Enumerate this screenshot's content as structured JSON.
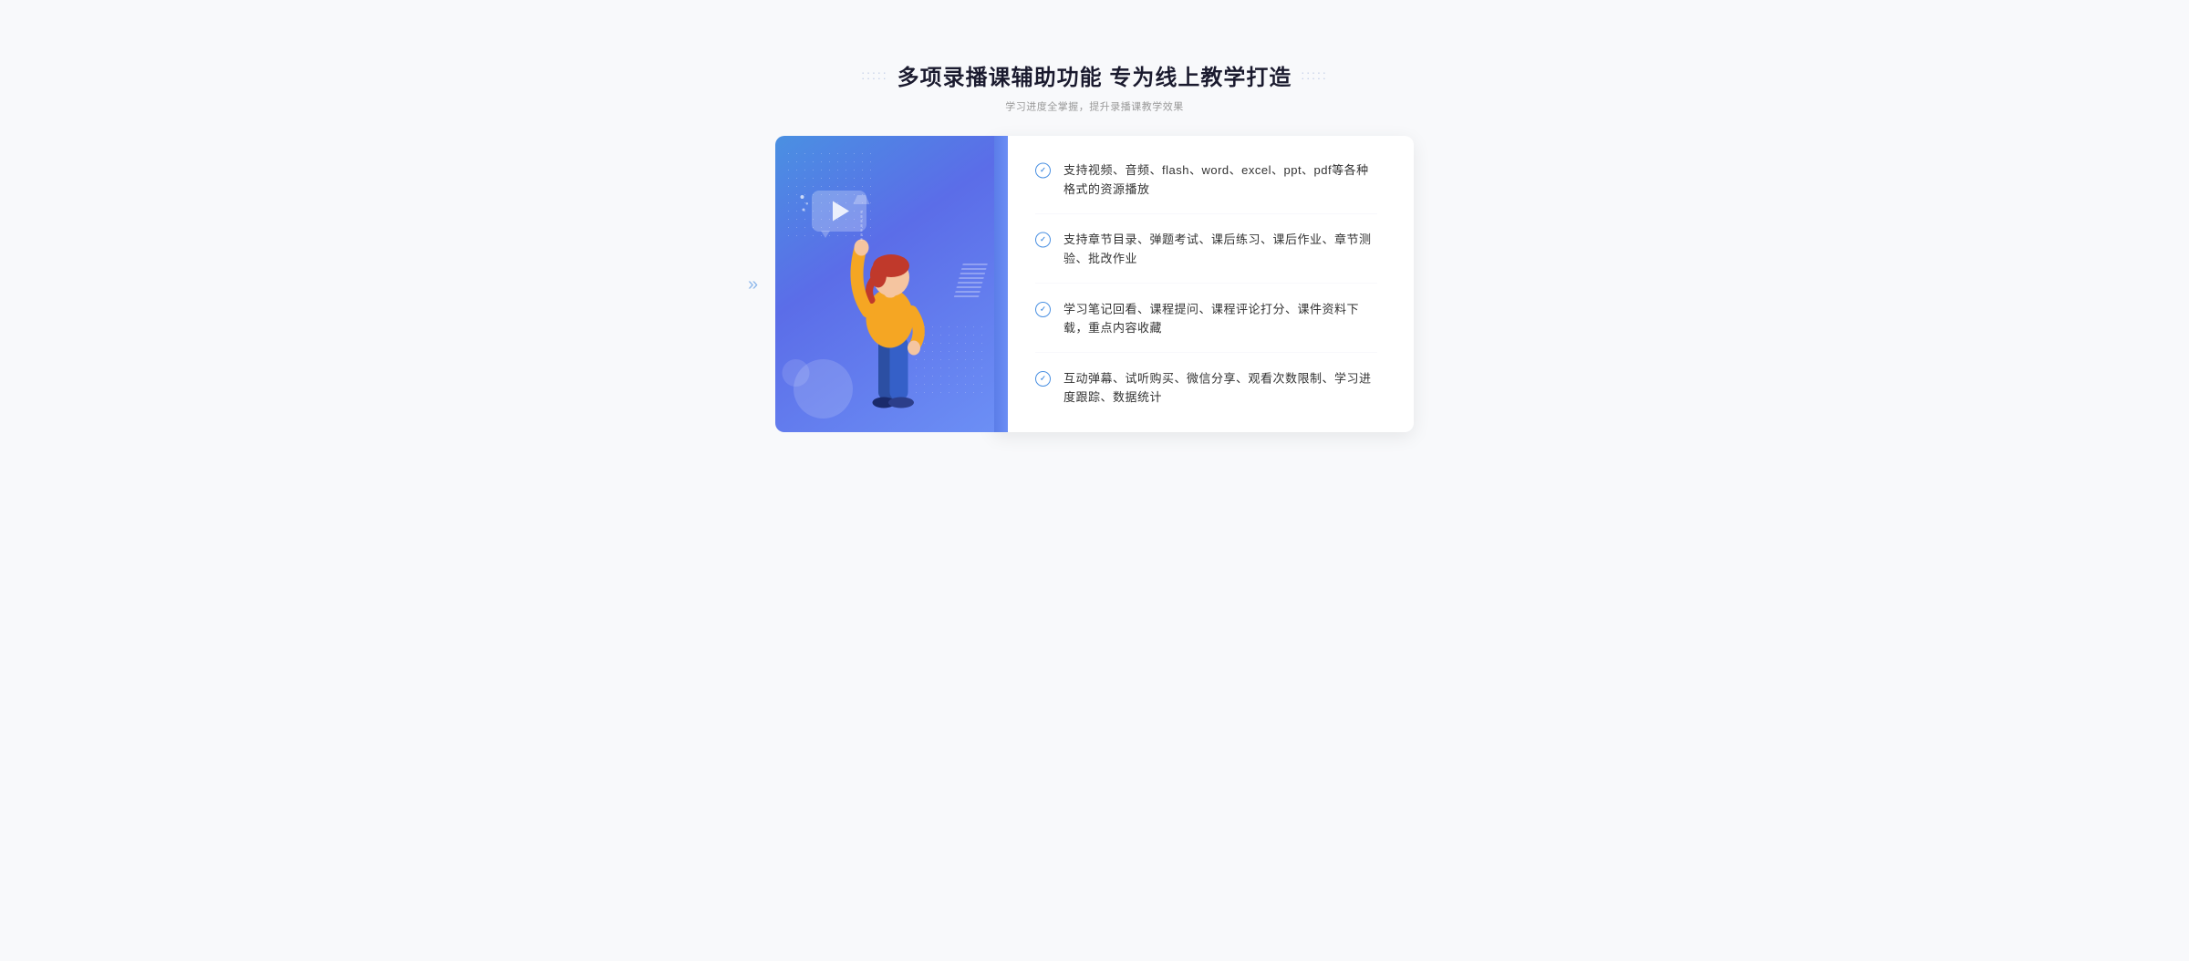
{
  "header": {
    "title": "多项录播课辅助功能 专为线上教学打造",
    "subtitle": "学习进度全掌握，提升录播课教学效果",
    "deco_left": ":::::",
    "deco_right": ":::::"
  },
  "features": [
    {
      "id": 1,
      "text": "支持视频、音频、flash、word、excel、ppt、pdf等各种格式的资源播放"
    },
    {
      "id": 2,
      "text": "支持章节目录、弹题考试、课后练习、课后作业、章节测验、批改作业"
    },
    {
      "id": 3,
      "text": "学习笔记回看、课程提问、课程评论打分、课件资料下载，重点内容收藏"
    },
    {
      "id": 4,
      "text": "互动弹幕、试听购买、微信分享、观看次数限制、学习进度跟踪、数据统计"
    }
  ],
  "chevron": "»",
  "colors": {
    "primary": "#4a90e2",
    "text_dark": "#1a1a2e",
    "text_gray": "#999",
    "text_body": "#333",
    "bg": "#f8f9fb",
    "white": "#ffffff"
  }
}
